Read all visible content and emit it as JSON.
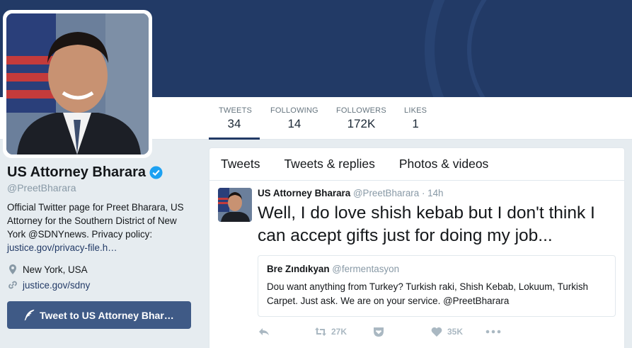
{
  "stats": [
    {
      "label": "TWEETS",
      "value": "34"
    },
    {
      "label": "FOLLOWING",
      "value": "14"
    },
    {
      "label": "FOLLOWERS",
      "value": "172K"
    },
    {
      "label": "LIKES",
      "value": "1"
    }
  ],
  "profile": {
    "name": "US Attorney Bharara",
    "handle": "@PreetBharara",
    "bio_text": "Official Twitter page for Preet Bharara, US Attorney for the Southern District of New York @SDNYnews. Privacy policy:",
    "bio_link": "justice.gov/privacy-file.h…",
    "location": "New York, USA",
    "website": "justice.gov/sdny",
    "tweet_to_label": "Tweet to US Attorney Bhar…"
  },
  "tabs": [
    "Tweets",
    "Tweets & replies",
    "Photos & videos"
  ],
  "tweet": {
    "name": "US Attorney Bharara",
    "handle": "@PreetBharara",
    "time": "· 14h",
    "text": "Well, I do love shish kebab but I don't think I can accept gifts just for doing my job...",
    "quote": {
      "name": "Bre Zındıkyan",
      "handle": "@fermentasyon",
      "text": "Dou want anything from Turkey? Turkish raki, Shish Kebab, Lokuum, Turkish Carpet. Just ask. We are on your service. @PreetBharara"
    },
    "retweets": "27K",
    "likes": "35K"
  },
  "colors": {
    "banner": "#223a66",
    "accent": "#223a66",
    "button": "#3f5a86",
    "verified": "#1da1f2"
  }
}
